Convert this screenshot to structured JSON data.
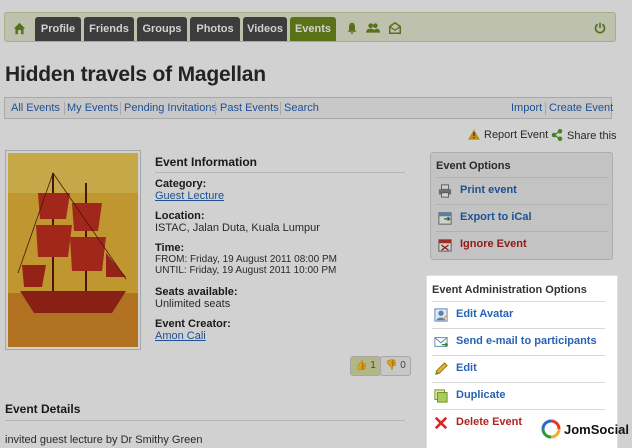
{
  "nav": {
    "tabs": [
      "Profile",
      "Friends",
      "Groups",
      "Photos",
      "Videos",
      "Events"
    ],
    "active_tab": "Events",
    "icons": [
      "home-icon",
      "notifications-icon",
      "friends-icon",
      "messages-icon",
      "power-icon"
    ]
  },
  "page": {
    "title": "Hidden travels of Magellan"
  },
  "subnav": {
    "left": [
      "All Events",
      "My Events",
      "Pending Invitations",
      "Past Events",
      "Search"
    ],
    "right": [
      "Import",
      "Create Event"
    ]
  },
  "actions": {
    "report": "Report Event",
    "share": "Share this"
  },
  "event": {
    "info_heading": "Event Information",
    "category_label": "Category:",
    "category_value": "Guest Lecture",
    "location_label": "Location:",
    "location_value": "ISTAC, Jalan Duta, Kuala Lumpur",
    "time_label": "Time:",
    "time_from": "FROM: Friday, 19 August 2011 08:00 PM",
    "time_until": "UNTIL: Friday, 19 August 2011 10:00 PM",
    "seats_label": "Seats available:",
    "seats_value": "Unlimited seats",
    "creator_label": "Event Creator:",
    "creator_value": "Amon Cali",
    "likes": "1",
    "dislikes": "0"
  },
  "details": {
    "heading": "Event Details",
    "text": "invited guest lecture by Dr Smithy Green"
  },
  "options": {
    "heading": "Event Options",
    "items": [
      "Print event",
      "Export to iCal",
      "Ignore Event"
    ]
  },
  "admin": {
    "heading": "Event Administration Options",
    "items": [
      "Edit Avatar",
      "Send e-mail to participants",
      "Edit",
      "Duplicate",
      "Delete Event"
    ]
  },
  "brand": {
    "name": "JomSocial"
  },
  "colors": {
    "nav_active": "#6d8c1e",
    "link": "#2763b4",
    "danger": "#b22222"
  }
}
